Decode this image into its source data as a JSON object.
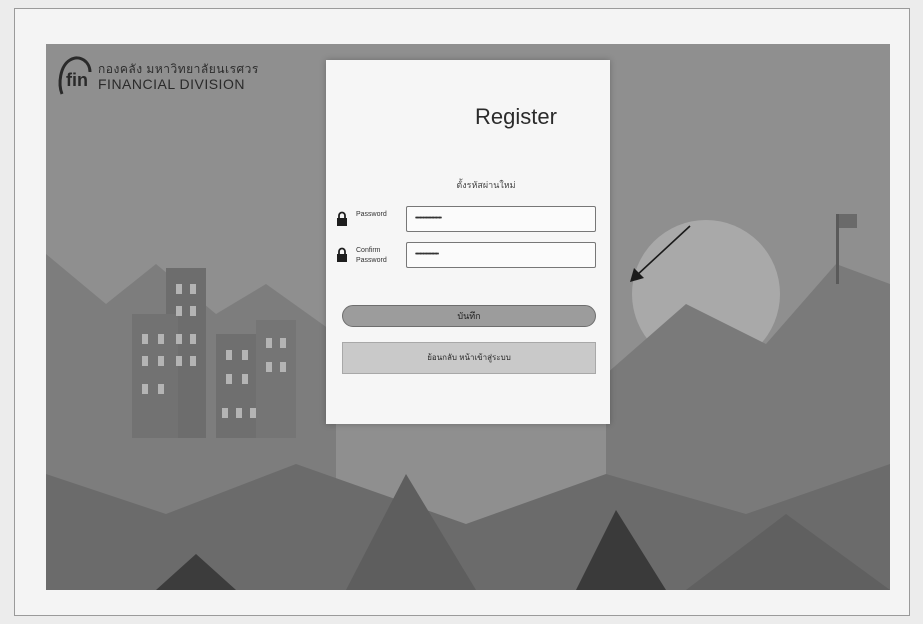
{
  "brand": {
    "thai_name": "กองคลัง มหาวิทยาลัยนเรศวร",
    "english_name": "FINANCIAL DIVISION"
  },
  "register": {
    "title": "Register",
    "subtitle": "ตั้งรหัสผ่านใหม่",
    "password_label": "Password",
    "password_value": "••••••••••••••••••",
    "confirm_label": "Confirm Password",
    "confirm_value": "••••••••••••••••",
    "submit_label": "บันทึก",
    "back_label": "ย้อนกลับ หน้าเข้าสู่ระบบ"
  },
  "colors": {
    "background": "#8e8e8e",
    "card": "#f6f6f6",
    "submit_button": "#9c9c9c",
    "back_button": "#c9c9c9"
  }
}
